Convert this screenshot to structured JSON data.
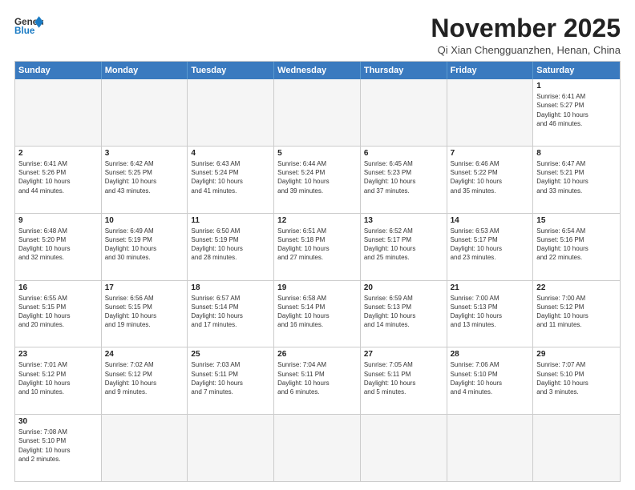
{
  "header": {
    "logo_line1": "General",
    "logo_line2": "Blue",
    "month_title": "November 2025",
    "location": "Qi Xian Chengguanzhen, Henan, China"
  },
  "day_headers": [
    "Sunday",
    "Monday",
    "Tuesday",
    "Wednesday",
    "Thursday",
    "Friday",
    "Saturday"
  ],
  "weeks": [
    [
      {
        "num": "",
        "empty": true,
        "info": ""
      },
      {
        "num": "",
        "empty": true,
        "info": ""
      },
      {
        "num": "",
        "empty": true,
        "info": ""
      },
      {
        "num": "",
        "empty": true,
        "info": ""
      },
      {
        "num": "",
        "empty": true,
        "info": ""
      },
      {
        "num": "",
        "empty": true,
        "info": ""
      },
      {
        "num": "1",
        "empty": false,
        "info": "Sunrise: 6:41 AM\nSunset: 5:27 PM\nDaylight: 10 hours\nand 46 minutes."
      }
    ],
    [
      {
        "num": "2",
        "empty": false,
        "info": "Sunrise: 6:41 AM\nSunset: 5:26 PM\nDaylight: 10 hours\nand 44 minutes."
      },
      {
        "num": "3",
        "empty": false,
        "info": "Sunrise: 6:42 AM\nSunset: 5:25 PM\nDaylight: 10 hours\nand 43 minutes."
      },
      {
        "num": "4",
        "empty": false,
        "info": "Sunrise: 6:43 AM\nSunset: 5:24 PM\nDaylight: 10 hours\nand 41 minutes."
      },
      {
        "num": "5",
        "empty": false,
        "info": "Sunrise: 6:44 AM\nSunset: 5:24 PM\nDaylight: 10 hours\nand 39 minutes."
      },
      {
        "num": "6",
        "empty": false,
        "info": "Sunrise: 6:45 AM\nSunset: 5:23 PM\nDaylight: 10 hours\nand 37 minutes."
      },
      {
        "num": "7",
        "empty": false,
        "info": "Sunrise: 6:46 AM\nSunset: 5:22 PM\nDaylight: 10 hours\nand 35 minutes."
      },
      {
        "num": "8",
        "empty": false,
        "info": "Sunrise: 6:47 AM\nSunset: 5:21 PM\nDaylight: 10 hours\nand 33 minutes."
      }
    ],
    [
      {
        "num": "9",
        "empty": false,
        "info": "Sunrise: 6:48 AM\nSunset: 5:20 PM\nDaylight: 10 hours\nand 32 minutes."
      },
      {
        "num": "10",
        "empty": false,
        "info": "Sunrise: 6:49 AM\nSunset: 5:19 PM\nDaylight: 10 hours\nand 30 minutes."
      },
      {
        "num": "11",
        "empty": false,
        "info": "Sunrise: 6:50 AM\nSunset: 5:19 PM\nDaylight: 10 hours\nand 28 minutes."
      },
      {
        "num": "12",
        "empty": false,
        "info": "Sunrise: 6:51 AM\nSunset: 5:18 PM\nDaylight: 10 hours\nand 27 minutes."
      },
      {
        "num": "13",
        "empty": false,
        "info": "Sunrise: 6:52 AM\nSunset: 5:17 PM\nDaylight: 10 hours\nand 25 minutes."
      },
      {
        "num": "14",
        "empty": false,
        "info": "Sunrise: 6:53 AM\nSunset: 5:17 PM\nDaylight: 10 hours\nand 23 minutes."
      },
      {
        "num": "15",
        "empty": false,
        "info": "Sunrise: 6:54 AM\nSunset: 5:16 PM\nDaylight: 10 hours\nand 22 minutes."
      }
    ],
    [
      {
        "num": "16",
        "empty": false,
        "info": "Sunrise: 6:55 AM\nSunset: 5:15 PM\nDaylight: 10 hours\nand 20 minutes."
      },
      {
        "num": "17",
        "empty": false,
        "info": "Sunrise: 6:56 AM\nSunset: 5:15 PM\nDaylight: 10 hours\nand 19 minutes."
      },
      {
        "num": "18",
        "empty": false,
        "info": "Sunrise: 6:57 AM\nSunset: 5:14 PM\nDaylight: 10 hours\nand 17 minutes."
      },
      {
        "num": "19",
        "empty": false,
        "info": "Sunrise: 6:58 AM\nSunset: 5:14 PM\nDaylight: 10 hours\nand 16 minutes."
      },
      {
        "num": "20",
        "empty": false,
        "info": "Sunrise: 6:59 AM\nSunset: 5:13 PM\nDaylight: 10 hours\nand 14 minutes."
      },
      {
        "num": "21",
        "empty": false,
        "info": "Sunrise: 7:00 AM\nSunset: 5:13 PM\nDaylight: 10 hours\nand 13 minutes."
      },
      {
        "num": "22",
        "empty": false,
        "info": "Sunrise: 7:00 AM\nSunset: 5:12 PM\nDaylight: 10 hours\nand 11 minutes."
      }
    ],
    [
      {
        "num": "23",
        "empty": false,
        "info": "Sunrise: 7:01 AM\nSunset: 5:12 PM\nDaylight: 10 hours\nand 10 minutes."
      },
      {
        "num": "24",
        "empty": false,
        "info": "Sunrise: 7:02 AM\nSunset: 5:12 PM\nDaylight: 10 hours\nand 9 minutes."
      },
      {
        "num": "25",
        "empty": false,
        "info": "Sunrise: 7:03 AM\nSunset: 5:11 PM\nDaylight: 10 hours\nand 7 minutes."
      },
      {
        "num": "26",
        "empty": false,
        "info": "Sunrise: 7:04 AM\nSunset: 5:11 PM\nDaylight: 10 hours\nand 6 minutes."
      },
      {
        "num": "27",
        "empty": false,
        "info": "Sunrise: 7:05 AM\nSunset: 5:11 PM\nDaylight: 10 hours\nand 5 minutes."
      },
      {
        "num": "28",
        "empty": false,
        "info": "Sunrise: 7:06 AM\nSunset: 5:10 PM\nDaylight: 10 hours\nand 4 minutes."
      },
      {
        "num": "29",
        "empty": false,
        "info": "Sunrise: 7:07 AM\nSunset: 5:10 PM\nDaylight: 10 hours\nand 3 minutes."
      }
    ],
    [
      {
        "num": "30",
        "empty": false,
        "info": "Sunrise: 7:08 AM\nSunset: 5:10 PM\nDaylight: 10 hours\nand 2 minutes."
      },
      {
        "num": "",
        "empty": true,
        "info": ""
      },
      {
        "num": "",
        "empty": true,
        "info": ""
      },
      {
        "num": "",
        "empty": true,
        "info": ""
      },
      {
        "num": "",
        "empty": true,
        "info": ""
      },
      {
        "num": "",
        "empty": true,
        "info": ""
      },
      {
        "num": "",
        "empty": true,
        "info": ""
      }
    ]
  ]
}
